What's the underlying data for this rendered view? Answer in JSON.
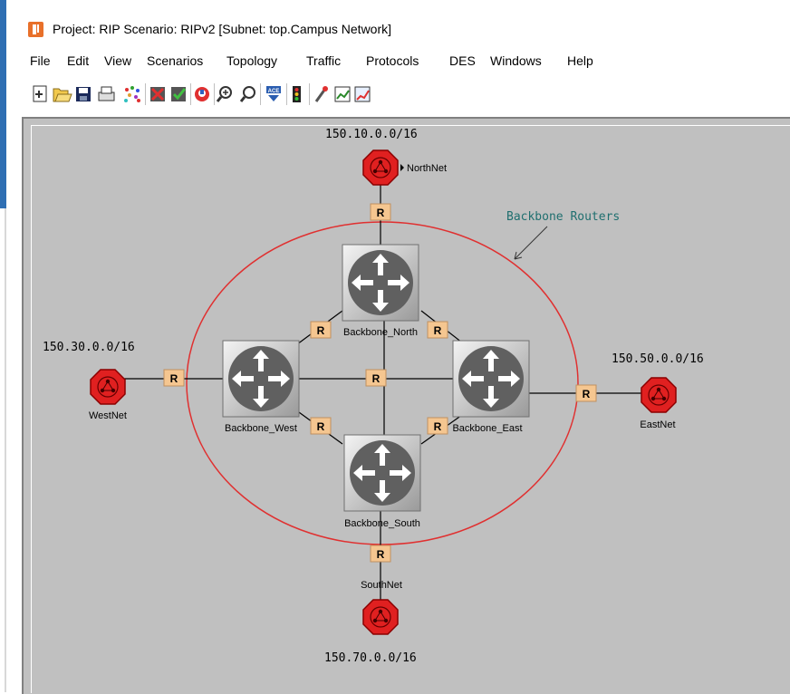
{
  "window": {
    "title": "Project: RIP Scenario: RIPv2  [Subnet: top.Campus Network]"
  },
  "menu": [
    "File",
    "Edit",
    "View",
    "Scenarios",
    "Topology",
    "Traffic",
    "Protocols",
    "DES",
    "Windows",
    "Help"
  ],
  "toolbar": {
    "buttons": [
      "new-icon",
      "open-icon",
      "save-icon",
      "print-icon",
      "object-palette-icon",
      "delete-icon",
      "check-links-icon",
      "fail-node-icon",
      "zoom-in-icon",
      "zoom-out-icon",
      "ace-icon",
      "configure-des-icon",
      "run-des-icon",
      "view-results-icon",
      "results-graph-icon"
    ],
    "ace_label": "ACE"
  },
  "network": {
    "subnets": {
      "north": {
        "label": "NorthNet",
        "address": "150.10.0.0/16"
      },
      "west": {
        "label": "WestNet",
        "address": "150.30.0.0/16"
      },
      "east": {
        "label": "EastNet",
        "address": "150.50.0.0/16"
      },
      "south": {
        "label": "SouthNet",
        "address": "150.70.0.0/16"
      }
    },
    "routers": {
      "north": "Backbone_North",
      "west": "Backbone_West",
      "east": "Backbone_East",
      "south": "Backbone_South"
    },
    "link_marker": "R",
    "annotation": "Backbone Routers"
  },
  "colors": {
    "canvas": "#c0c0c0",
    "subnet": "#e02020",
    "ellipse": "#e03030",
    "link_marker": "#f5c690",
    "annotation": "#1f6f6f"
  }
}
